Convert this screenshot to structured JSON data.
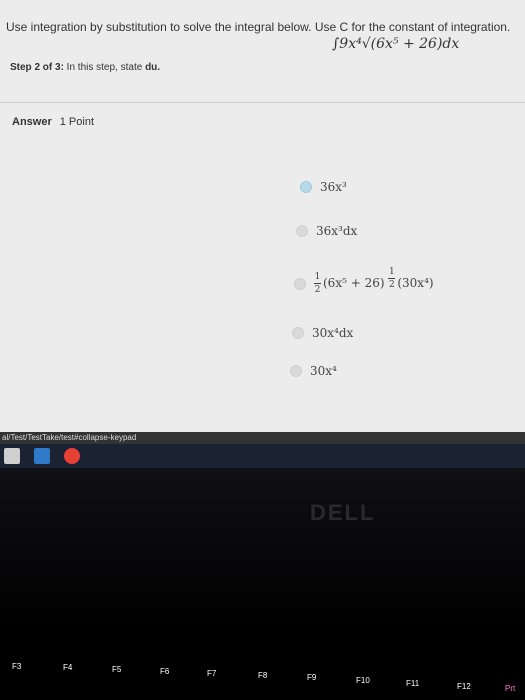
{
  "question": {
    "text": "Use integration by substitution to solve the integral below. Use C for the constant of integration.",
    "integral": "∫9x⁴√(6x⁵ + 26)dx"
  },
  "step": {
    "prefix": "Step 2 of 3:",
    "text": " In this step, state ",
    "emph": "du."
  },
  "answer": {
    "label": "Answer",
    "points": "1 Point"
  },
  "options": [
    {
      "text": "36x³"
    },
    {
      "text": "36x³dx"
    },
    {
      "frac_num": "1",
      "frac_den": "2",
      "text": "(6x⁵ + 26)",
      "exp_num": "1",
      "exp_den": "2",
      "tail": "(30x⁴)"
    },
    {
      "text": "30x⁴dx"
    },
    {
      "text": "30x⁴"
    }
  ],
  "url": "al/Test/TestTake/test#collapse-keypad",
  "brand": "DELL",
  "fkeys": [
    "F3",
    "F4",
    "F5",
    "F6",
    "F7",
    "F8",
    "F9",
    "F10",
    "F11",
    "F12",
    "Prt"
  ]
}
